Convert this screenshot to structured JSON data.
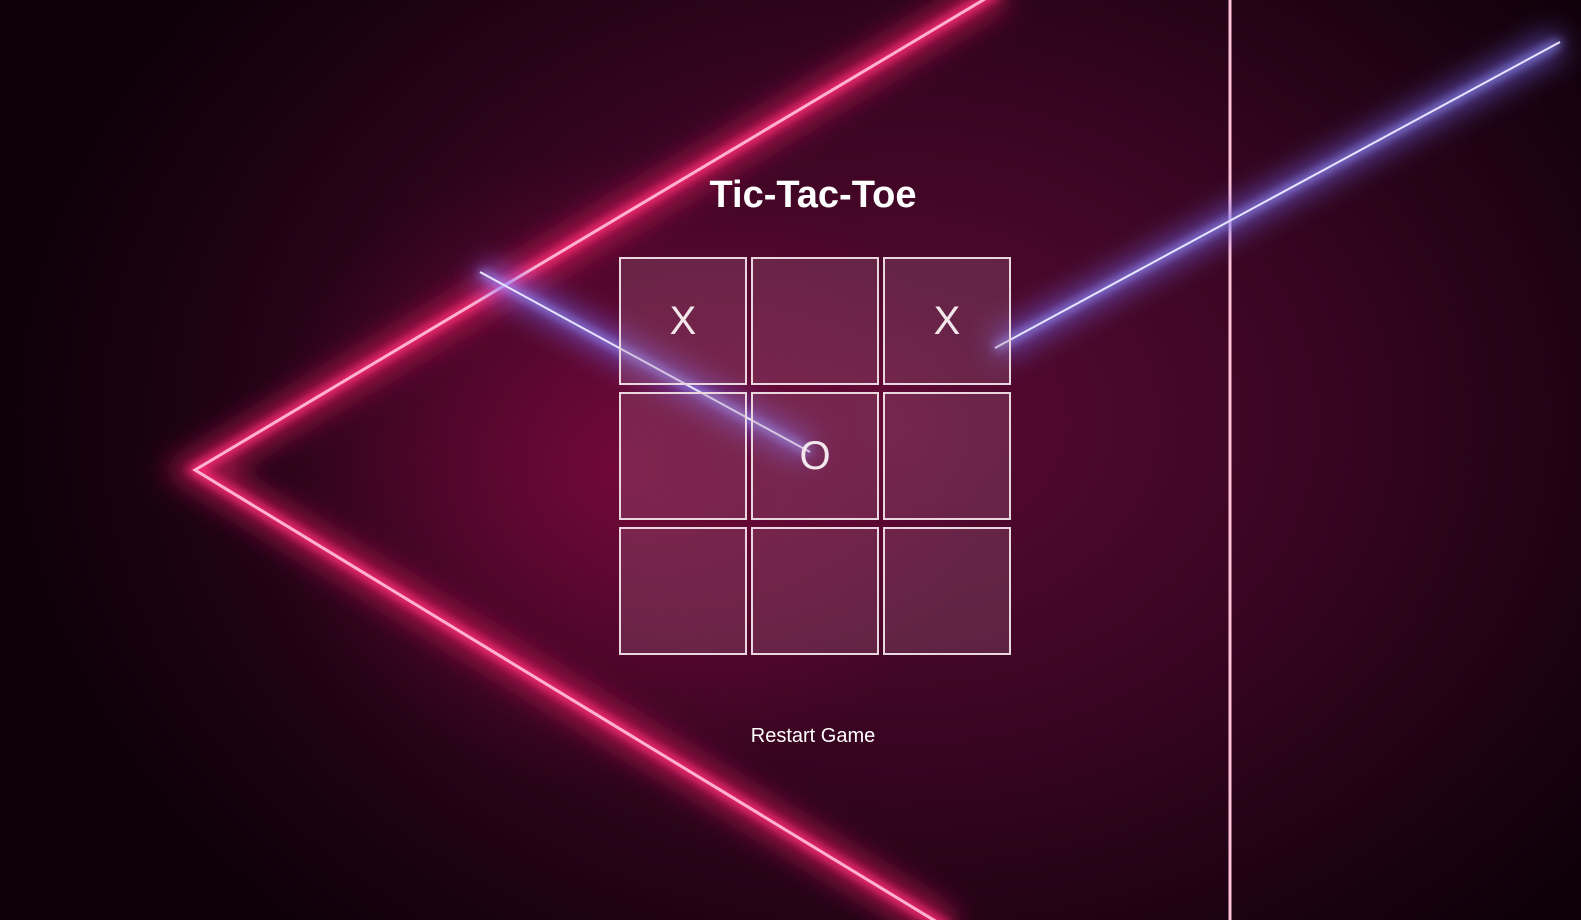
{
  "title": "Tic-Tac-Toe",
  "board": {
    "cells": [
      "X",
      "",
      "X",
      "",
      "O",
      "",
      "",
      "",
      ""
    ]
  },
  "restart_label": "Restart Game",
  "colors": {
    "background": "#3a0522",
    "neon_pink": "#ff1f6b",
    "neon_blue": "#8f8cff",
    "cell_border": "#e9d6df",
    "text": "#ffffff"
  }
}
